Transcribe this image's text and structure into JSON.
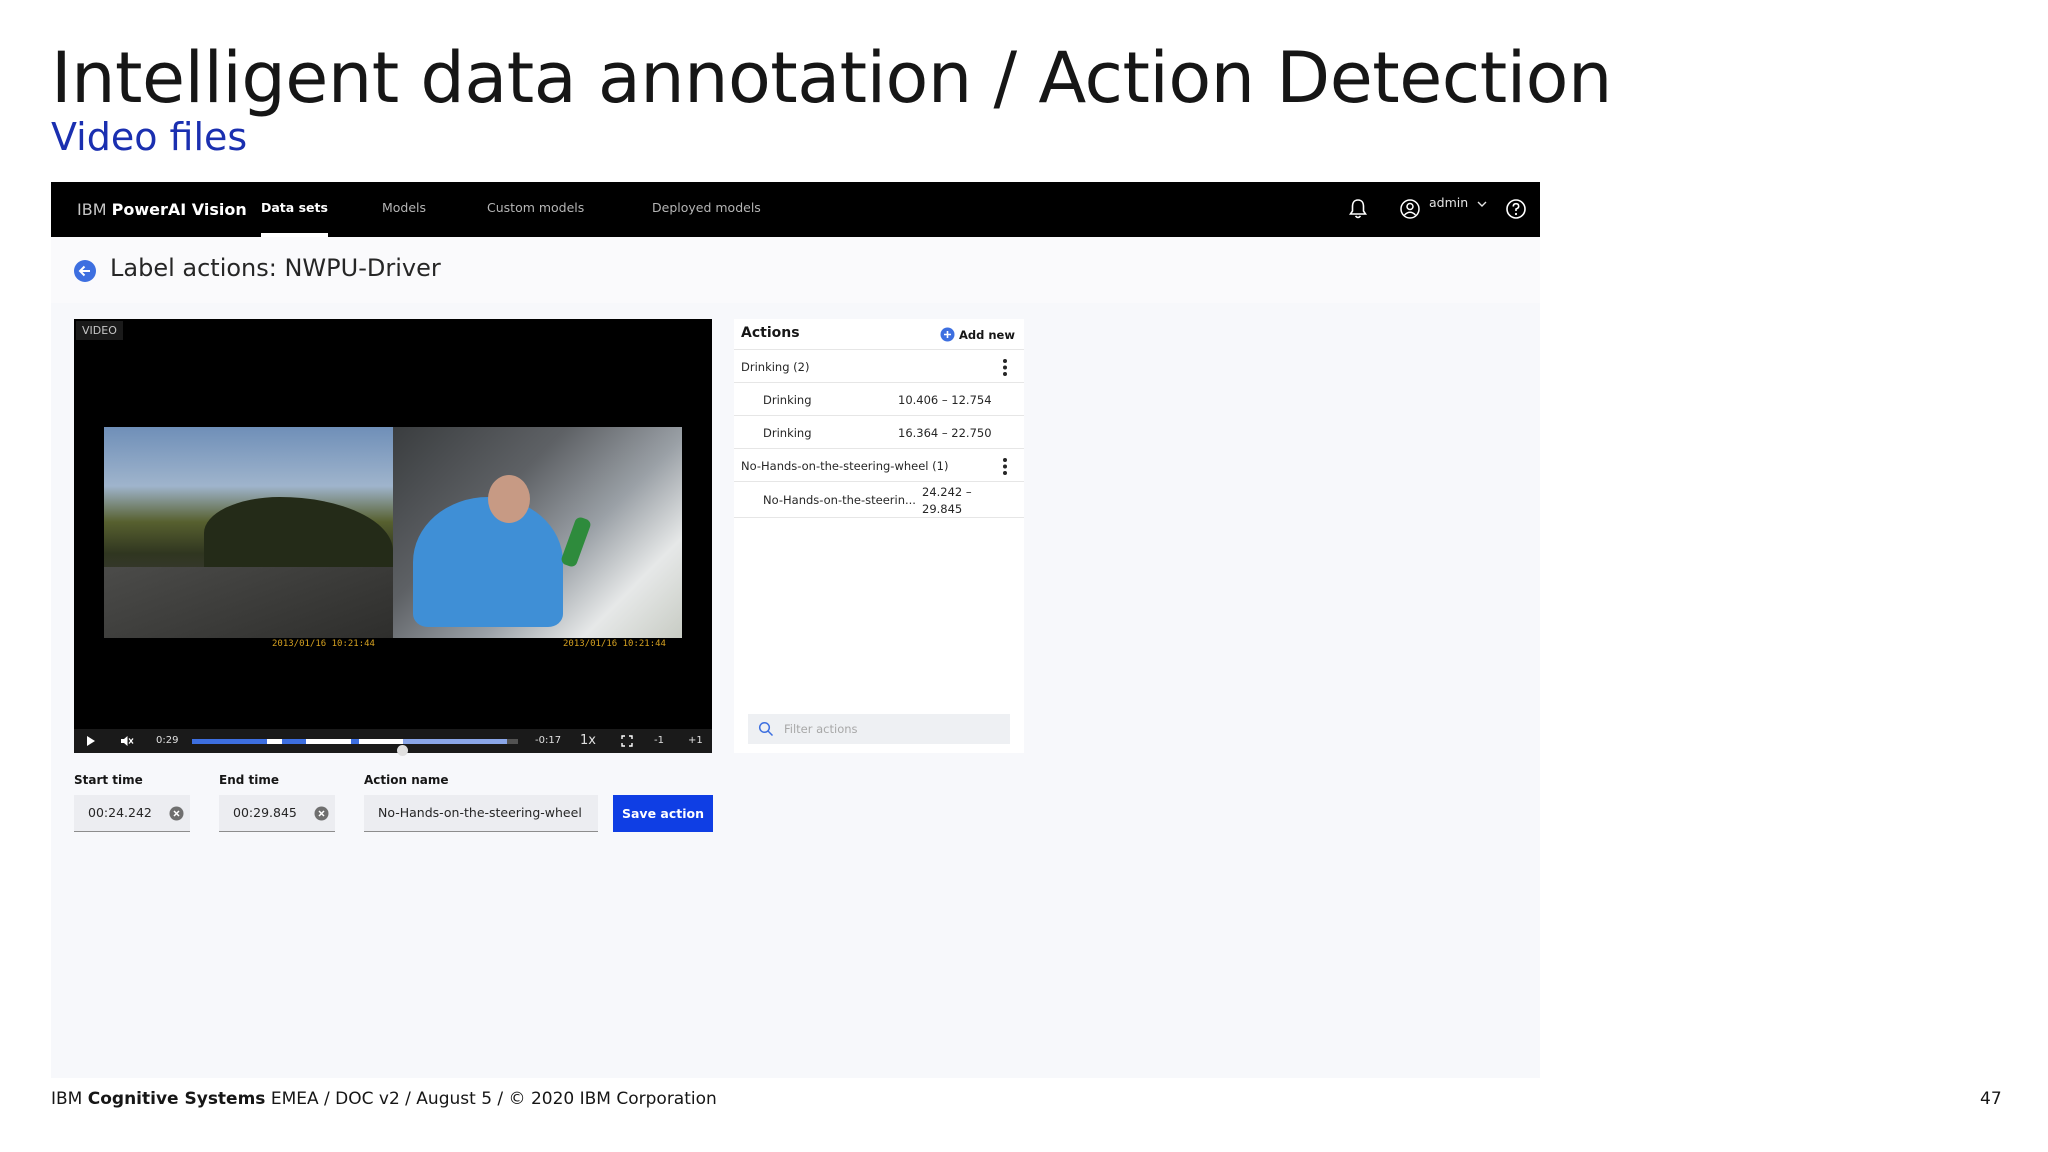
{
  "slide": {
    "title": "Intelligent data annotation / Action Detection",
    "subtitle": "Video files",
    "footer": {
      "brand_prefix": "IBM ",
      "brand_bold": "Cognitive Systems",
      "rest": " EMEA / DOC v2 / August 5 / © 2020 IBM Corporation"
    },
    "page_number": "47"
  },
  "app": {
    "brand_prefix": "IBM ",
    "brand_name": "PowerAI Vision",
    "nav_tabs": [
      {
        "label": "Data sets",
        "active": true
      },
      {
        "label": "Models",
        "active": false
      },
      {
        "label": "Custom models",
        "active": false
      },
      {
        "label": "Deployed models",
        "active": false
      }
    ],
    "user": "admin",
    "icons": {
      "notifications": "bell-icon",
      "user": "user-avatar-icon",
      "help": "help-icon"
    },
    "accent": "#0f3ee4"
  },
  "page": {
    "title": "Label actions: NWPU-Driver"
  },
  "video": {
    "badge": "VIDEO",
    "stamp_left": "2013/01/16  10:21:44",
    "stamp_right": "2013/01/16  10:21:44",
    "elapsed": "0:29",
    "remaining": "-0:17",
    "speed": "1x",
    "step_back": "-1",
    "step_forward": "+1",
    "progress": 0.65
  },
  "form": {
    "start_time_label": "Start time",
    "start_time_value": "00:24.242",
    "end_time_label": "End time",
    "end_time_value": "00:29.845",
    "action_name_label": "Action name",
    "action_name_value": "No-Hands-on-the-steering-wheel",
    "save_label": "Save action"
  },
  "actions_panel": {
    "title": "Actions",
    "add_label": "Add new",
    "groups": [
      {
        "label": "Drinking (2)",
        "items": [
          {
            "name": "Drinking",
            "time": "10.406 – 12.754"
          },
          {
            "name": "Drinking",
            "time": "16.364 – 22.750"
          }
        ]
      },
      {
        "label": "No-Hands-on-the-steering-wheel (1)",
        "items": [
          {
            "name": "No-Hands-on-the-steerin...",
            "time": "24.242 – 29.845"
          }
        ]
      }
    ],
    "filter_placeholder": "Filter actions"
  }
}
